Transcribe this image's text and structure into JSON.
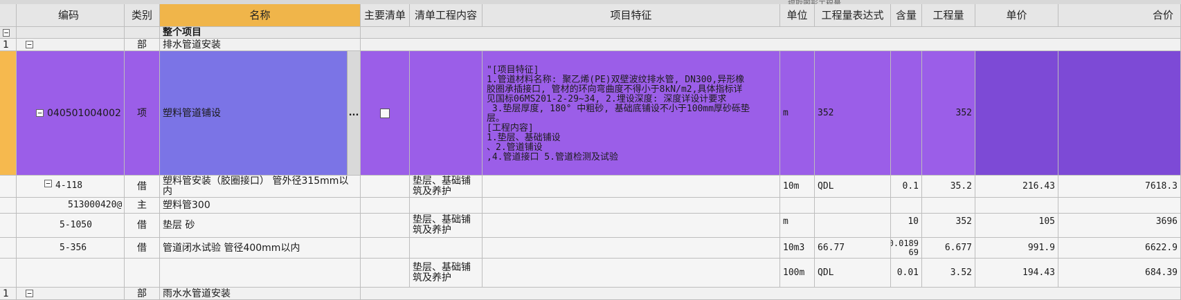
{
  "toolbar": {
    "ghost_text": "提取图形工程量"
  },
  "columns": {
    "code": "编码",
    "category": "类别",
    "name": "名称",
    "main_list": "主要清单",
    "list_content": "清单工程内容",
    "feature": "项目特征",
    "unit": "单位",
    "expr": "工程量表达式",
    "content": "含量",
    "qty": "工程量",
    "price": "单价",
    "total": "合价"
  },
  "rows": {
    "whole": {
      "toggle": "−",
      "name": "整个项目"
    },
    "section1": {
      "index": "1",
      "toggle": "−",
      "category": "部",
      "name": "排水管道安装"
    },
    "item": {
      "toggle": "−",
      "code": "040501004002",
      "category": "项",
      "name": "塑料管道铺设",
      "ellipsis": "...",
      "unit": "m",
      "expr": "352",
      "qty": "352",
      "feature_lines": [
        "\"[项目特征]",
        "1.管道材料名称: 聚乙烯(PE)双壁波纹排水管, DN300,异形橡",
        "胶圈承插接口, 管材的环向弯曲度不得小于8kN/m2,具体指标详",
        "见国标06MS201-2-29~34, 2.埋设深度: 深度详设计要求",
        " 3.垫层厚度, 180° 中粗砂, 基础底铺设不小于100mm厚砂砾垫",
        "层。",
        "[工程内容]",
        "1.垫层、基础铺设",
        "、2.管道铺设",
        ",4.管道接口 5.管道检测及试验"
      ]
    },
    "sub1": {
      "toggle": "−",
      "code": "4-118",
      "category": "借",
      "name_line1": "塑料管安装（胶圈接口） 管外径315mm以",
      "name_line2": "内",
      "list_content_line1": "垫层、基础铺",
      "list_content_line2": "筑及养护",
      "unit": "10m",
      "expr": "QDL",
      "content": "0.1",
      "qty": "35.2",
      "price": "216.43",
      "total": "7618.3"
    },
    "sub1a": {
      "code": "513000420@",
      "category": "主",
      "name": "塑料管300"
    },
    "sub2": {
      "code": "5-1050",
      "category": "借",
      "name": "垫层 砂",
      "list_content_line1": "垫层、基础铺",
      "list_content_line2": "筑及养护",
      "unit": "m",
      "content": "10",
      "qty": "352",
      "price": "105",
      "total": "3696"
    },
    "sub3": {
      "code": "5-356",
      "category": "借",
      "name": "管道闭水试验 管径400mm以内",
      "unit": "10m3",
      "expr": "66.77",
      "content_line1": "0.0189",
      "content_line2": "69",
      "qty": "6.677",
      "price": "991.9",
      "total": "6622.9"
    },
    "sub4": {
      "list_content_line1": "垫层、基础铺",
      "list_content_line2": "筑及养护",
      "unit": "100m",
      "expr": "QDL",
      "content": "0.01",
      "qty": "3.52",
      "price": "194.43",
      "total": "684.39"
    },
    "section2": {
      "index": "1",
      "toggle": "−",
      "category": "部",
      "name": "雨水水管道安装"
    }
  }
}
